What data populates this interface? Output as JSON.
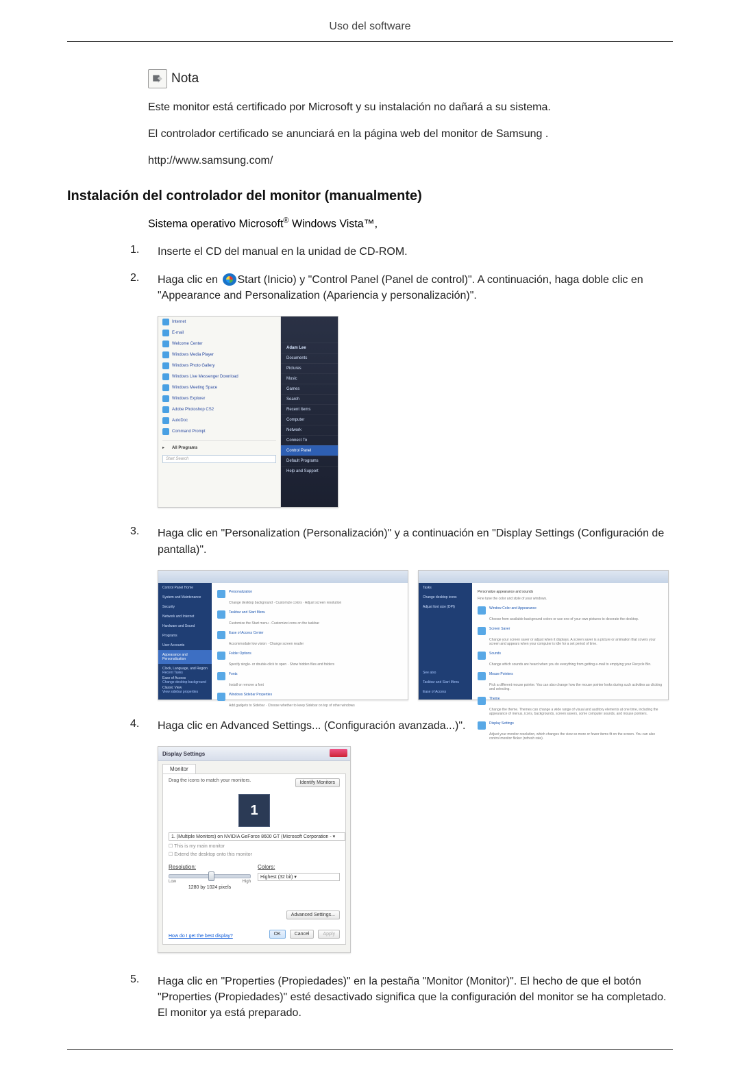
{
  "header": {
    "title": "Uso del software"
  },
  "note": {
    "label": "Nota",
    "p1": "Este monitor está certificado por Microsoft y su instalación no dañará a su sistema.",
    "p2": "El controlador certificado se anunciará en la página web del monitor de Samsung .",
    "p3": "http://www.samsung.com/"
  },
  "section": {
    "h2": "Instalación del controlador del monitor (manualmente)",
    "os_line_prefix": "Sistema operativo Microsoft",
    "os_reg": "®",
    "os_line_mid": " Windows Vista",
    "os_tm": "™",
    "os_line_suffix": ","
  },
  "steps": {
    "s1": {
      "num": "1.",
      "text": "Inserte el CD del manual en la unidad de CD-ROM."
    },
    "s2": {
      "num": "2.",
      "before_icon": "Haga clic en ",
      "after_icon": "Start (Inicio) y \"Control Panel (Panel de control)\". A continuación, haga doble clic en \"Appearance and Personalization (Apariencia y personalización)\"."
    },
    "s3": {
      "num": "3.",
      "text": "Haga clic en \"Personalization (Personalización)\" y a continuación en \"Display Settings (Configuración de pantalla)\"."
    },
    "s4": {
      "num": "4.",
      "text": "Haga clic en Advanced Settings... (Configuración avanzada...)\"."
    },
    "s5": {
      "num": "5.",
      "text": "Haga clic en \"Properties (Propiedades)\" en la pestaña \"Monitor (Monitor)\". El hecho de que el botón \"Properties (Propiedades)\" esté desactivado significa que la configuración del monitor se ha completado. El monitor ya está preparado."
    }
  },
  "shot1": {
    "menu": [
      "Internet\nInternet Explorer",
      "E-mail\nWindows Mail",
      "Welcome Center",
      "Windows Media Player",
      "Windows Photo Gallery",
      "Windows Live Messenger Download",
      "Windows Meeting Space",
      "Windows Explorer",
      "Adobe Photoshop CS2",
      "AutoDoc",
      "Command Prompt"
    ],
    "all_programs": "All Programs",
    "search_placeholder": "Start Search",
    "right": [
      "Documents",
      "Pictures",
      "Music",
      "Games",
      "Search",
      "Recent Items",
      "Computer",
      "Network",
      "Connect To",
      "Control Panel",
      "Default Programs",
      "Help and Support"
    ],
    "highlight": "Control Panel",
    "user_label": "Adam Lee"
  },
  "shot2": {
    "sidebar": [
      "Control Panel Home",
      "System and Maintenance",
      "Security",
      "Network and Internet",
      "Hardware and Sound",
      "Programs",
      "User Accounts",
      "Appearance and Personalization",
      "Clock, Language, and Region",
      "Ease of Access",
      "Classic View"
    ],
    "highlight": "Appearance and Personalization",
    "items": [
      {
        "t": "Personalization",
        "s": "Change desktop background · Customize colors · Adjust screen resolution"
      },
      {
        "t": "Taskbar and Start Menu",
        "s": "Customize the Start menu · Customize icons on the taskbar"
      },
      {
        "t": "Ease of Access Center",
        "s": "Accommodate low vision · Change screen reader"
      },
      {
        "t": "Folder Options",
        "s": "Specify single- or double-click to open · Show hidden files and folders"
      },
      {
        "t": "Fonts",
        "s": "Install or remove a font"
      },
      {
        "t": "Windows Sidebar Properties",
        "s": "Add gadgets to Sidebar · Choose whether to keep Sidebar on top of other windows"
      }
    ],
    "footer_links": [
      "Recent Tasks",
      "Change desktop background",
      "View sidebar properties"
    ]
  },
  "shot3": {
    "sidebar": [
      "Tasks",
      "Change desktop icons",
      "Adjust font size (DPI)"
    ],
    "heading": "Personalize appearance and sounds",
    "sub": "Fine tune the color and style of your windows.",
    "items": [
      {
        "t": "Window Color and Appearance",
        "s": "Choose from available background colors or use one of your own pictures to decorate the desktop."
      },
      {
        "t": "Screen Saver",
        "s": "Change your screen saver or adjust when it displays. A screen saver is a picture or animation that covers your screen and appears when your computer is idle for a set period of time."
      },
      {
        "t": "Sounds",
        "s": "Change which sounds are heard when you do everything from getting e-mail to emptying your Recycle Bin."
      },
      {
        "t": "Mouse Pointers",
        "s": "Pick a different mouse pointer. You can also change how the mouse pointer looks during such activities as clicking and selecting."
      },
      {
        "t": "Theme",
        "s": "Change the theme. Themes can change a wide range of visual and auditory elements at one time, including the appearance of menus, icons, backgrounds, screen savers, some computer sounds, and mouse pointers."
      },
      {
        "t": "Display Settings",
        "s": "Adjust your monitor resolution, which changes the view so more or fewer items fit on the screen. You can also control monitor flicker (refresh rate)."
      }
    ],
    "footer_links": [
      "See also",
      "Taskbar and Start Menu",
      "Ease of Access"
    ]
  },
  "shot4": {
    "title": "Display Settings",
    "tab": "Monitor",
    "drag": "Drag the icons to match your monitors.",
    "identify": "Identify Monitors",
    "preview": "1",
    "select": "1. (Multiple Monitors) on NVIDIA GeForce 8600 GT (Microsoft Corporation - ▾",
    "check1": "This is my main monitor",
    "check2": "Extend the desktop onto this monitor",
    "res_label": "Resolution:",
    "res_low": "Low",
    "res_high": "High",
    "res_value": "1280 by 1024 pixels",
    "color_label": "Colors:",
    "color_value": "Highest (32 bit)",
    "link": "How do I get the best display?",
    "adv": "Advanced Settings...",
    "ok": "OK",
    "cancel": "Cancel",
    "apply": "Apply"
  }
}
